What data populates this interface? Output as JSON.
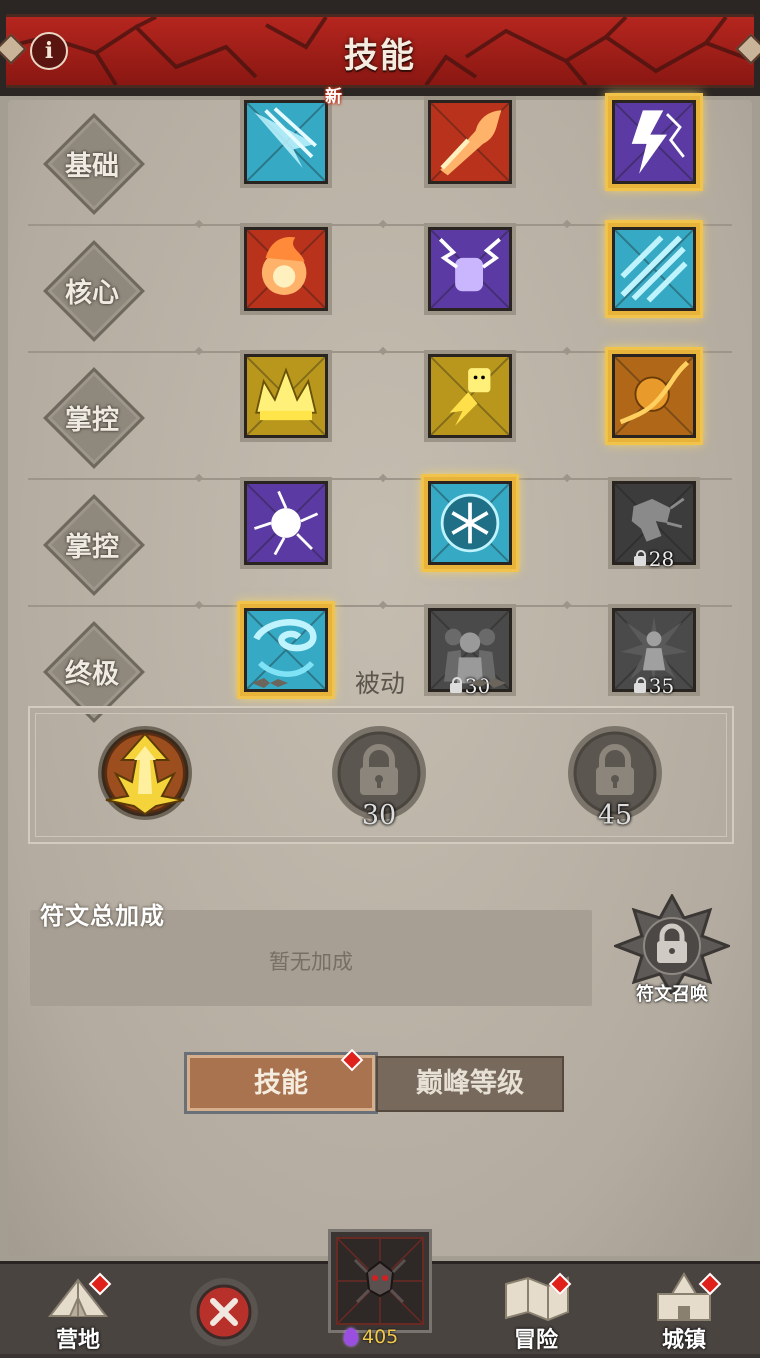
{
  "header": {
    "title": "技能",
    "info_icon": "i"
  },
  "skill_rows": [
    {
      "tier": "基础",
      "skills": [
        {
          "icon": "ice-arrow-icon",
          "color": "#36a9c4",
          "state": "unlocked",
          "badge": "新"
        },
        {
          "icon": "fire-arrow-icon",
          "color": "#b8321c",
          "state": "unlocked"
        },
        {
          "icon": "lightning-icon",
          "color": "#5b3aa3",
          "state": "selected"
        }
      ]
    },
    {
      "tier": "核心",
      "skills": [
        {
          "icon": "fireball-icon",
          "color": "#b8321c",
          "state": "unlocked"
        },
        {
          "icon": "lightning-fist-icon",
          "color": "#5b3aa3",
          "state": "unlocked"
        },
        {
          "icon": "ice-shards-icon",
          "color": "#36a9c4",
          "state": "selected"
        }
      ]
    },
    {
      "tier": "掌控",
      "skills": [
        {
          "icon": "golden-crown-icon",
          "color": "#b8971c",
          "state": "unlocked"
        },
        {
          "icon": "golden-figure-icon",
          "color": "#b8971c",
          "state": "unlocked"
        },
        {
          "icon": "meteor-icon",
          "color": "#b06818",
          "state": "selected"
        }
      ]
    },
    {
      "tier": "掌控",
      "skills": [
        {
          "icon": "lightning-orb-icon",
          "color": "#5b3aa3",
          "state": "unlocked"
        },
        {
          "icon": "snowflake-icon",
          "color": "#36a9c4",
          "state": "selected"
        },
        {
          "icon": "dragon-icon",
          "color": "#3c3c3c",
          "state": "locked",
          "level": "28"
        }
      ]
    },
    {
      "tier": "终极",
      "skills": [
        {
          "icon": "whirlwind-icon",
          "color": "#36a9c4",
          "state": "selected"
        },
        {
          "icon": "crowd-icon",
          "color": "#4a4a4a",
          "state": "locked",
          "level": "30"
        },
        {
          "icon": "hero-burst-icon",
          "color": "#4a4a4a",
          "state": "locked",
          "level": "35"
        }
      ]
    }
  ],
  "passive": {
    "title": "被动",
    "slots": [
      {
        "icon": "golden-arrow-up-icon",
        "state": "unlocked"
      },
      {
        "icon": "lock-icon",
        "state": "locked",
        "level": "30"
      },
      {
        "icon": "lock-icon",
        "state": "locked",
        "level": "45"
      }
    ]
  },
  "rune": {
    "title": "符文总加成",
    "empty_text": "暂无加成",
    "summon_label": "符文召唤"
  },
  "tabs": {
    "skills": "技能",
    "peak": "巅峰等级"
  },
  "nav": {
    "camp": "营地",
    "adventure": "冒险",
    "town": "城镇",
    "currency": "405"
  },
  "colors": {
    "header_red": "#a81e18",
    "selected_gold": "#f2c34b",
    "panel": "#b8b0a4"
  }
}
